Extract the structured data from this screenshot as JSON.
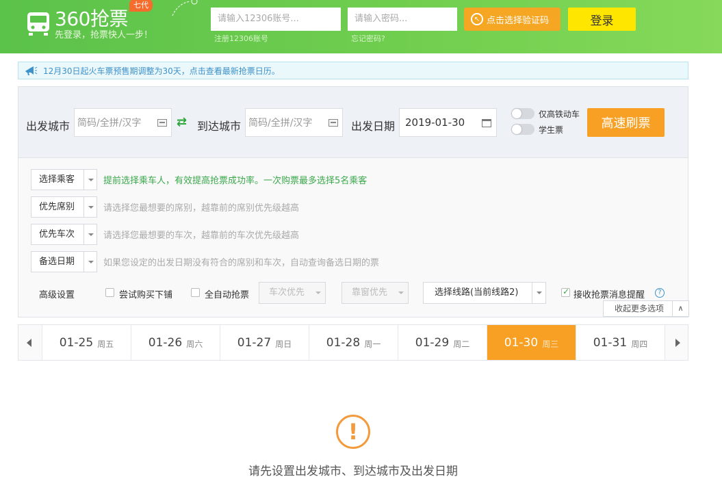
{
  "header": {
    "brand": "360抢票",
    "badge": "七代",
    "slogan": "先登录，抢票快人一步！",
    "account_placeholder": "请输入12306账号...",
    "password_placeholder": "请输入密码...",
    "register_link": "注册12306账号",
    "forgot_link": "忘记密码?",
    "captcha_button": "点击选择验证码",
    "login_button": "登录"
  },
  "notice": {
    "text": "12月30日起火车票预售期调整为30天，点击查看最新抢票日历。"
  },
  "search": {
    "from_label": "出发城市",
    "from_placeholder": "简码/全拼/汉字",
    "to_label": "到达城市",
    "to_placeholder": "简码/全拼/汉字",
    "date_label": "出发日期",
    "date_value": "2019-01-30",
    "toggle_highspeed": "仅高铁动车",
    "toggle_student": "学生票",
    "refresh_button": "高速刷票"
  },
  "options": {
    "passenger_select": "选择乘客",
    "passenger_hint": "提前选择乘车人，有效提高抢票成功率。一次购票最多选择5名乘客",
    "seat_select": "优先席别",
    "seat_hint": "请选择您最想要的席别，越靠前的席别优先级越高",
    "train_select": "优先车次",
    "train_hint": "请选择您最想要的车次，越靠前的车次优先级越高",
    "backup_date_select": "备选日期",
    "backup_date_hint": "如果您设定的出发日期没有符合的席别和车次，自动查询备选日期的票",
    "advanced_label": "高级设置",
    "try_lower_berth": "尝试购买下铺",
    "auto_grab": "全自动抢票",
    "train_priority": "车次优先",
    "window_priority": "靠窗优先",
    "route_select": "选择线路(当前线路2)",
    "receive_alert": "接收抢票消息提醒",
    "help": "?",
    "collapse": "收起更多选项"
  },
  "dates": [
    {
      "date": "01-25",
      "weekday": "周五",
      "active": false
    },
    {
      "date": "01-26",
      "weekday": "周六",
      "active": false
    },
    {
      "date": "01-27",
      "weekday": "周日",
      "active": false
    },
    {
      "date": "01-28",
      "weekday": "周一",
      "active": false
    },
    {
      "date": "01-29",
      "weekday": "周二",
      "active": false
    },
    {
      "date": "01-30",
      "weekday": "周三",
      "active": true
    },
    {
      "date": "01-31",
      "weekday": "周四",
      "active": false
    }
  ],
  "empty_state": {
    "icon": "!",
    "message": "请先设置出发城市、到达城市及出发日期"
  },
  "colors": {
    "header_green": "#5bc24a",
    "accent_orange": "#f7a024",
    "login_yellow": "#ffe600",
    "hint_green": "#3aa84a"
  }
}
